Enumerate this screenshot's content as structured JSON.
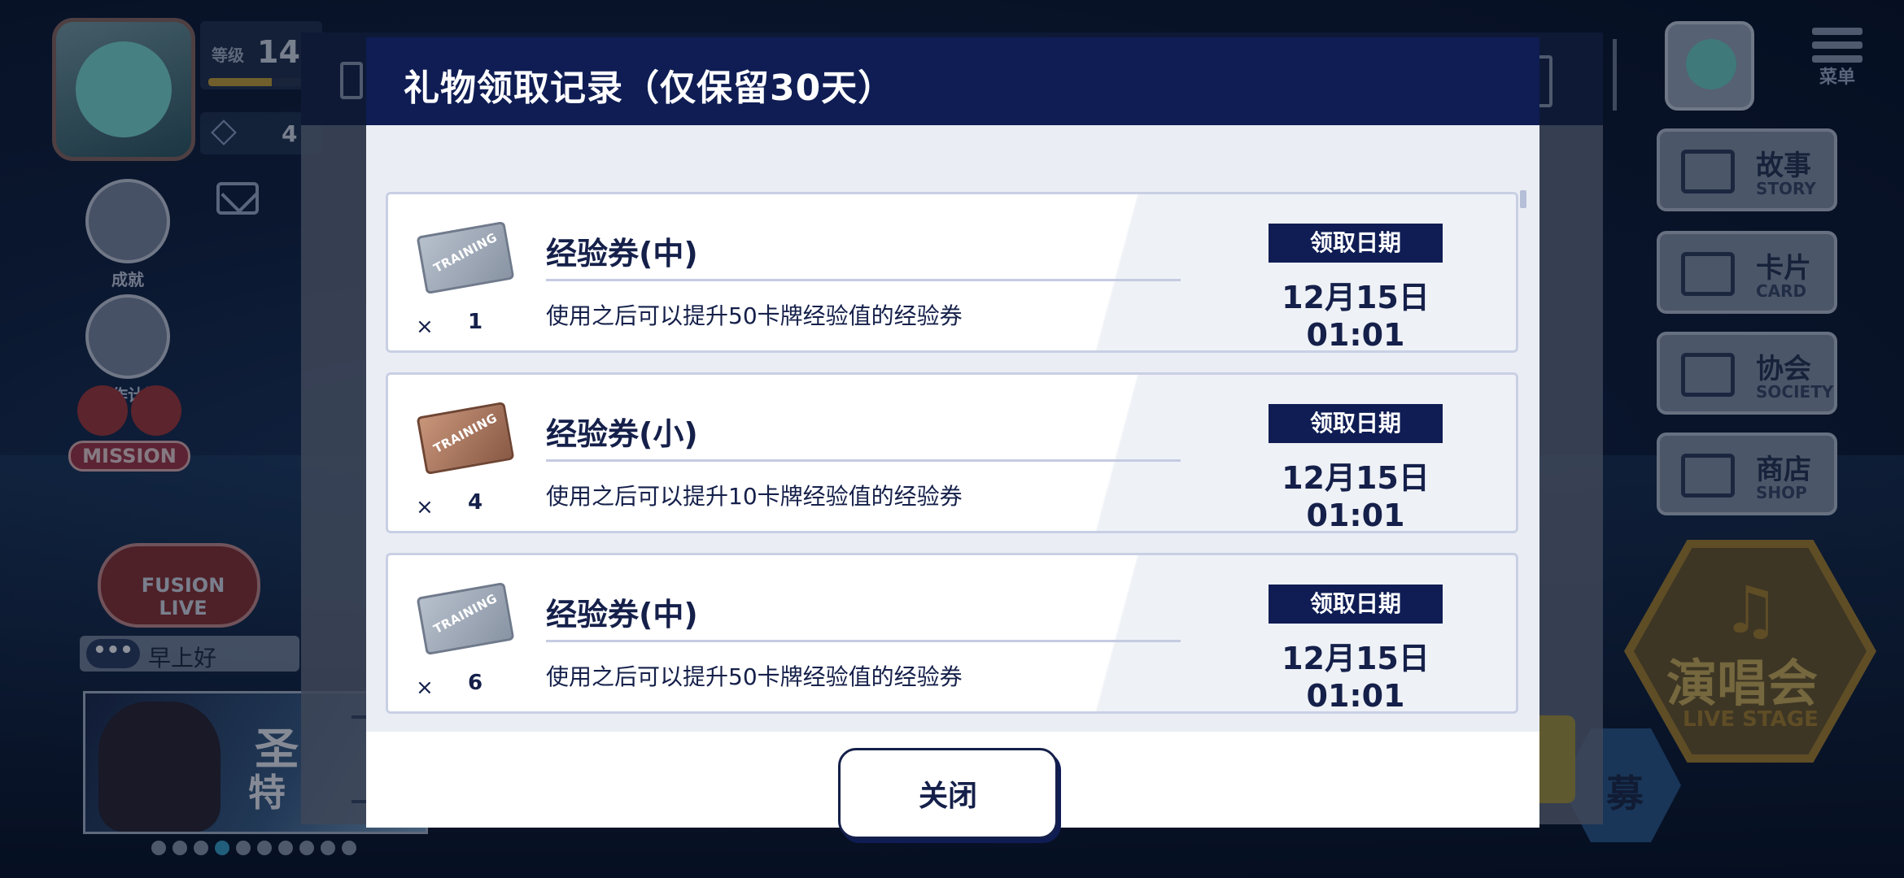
{
  "hud": {
    "level_label": "等级",
    "level_value": "14",
    "level_progress": 0.65,
    "gem_value": "4",
    "achievement_label": "成就",
    "work_plan_label": "工作计划",
    "mission_label": "MISSION",
    "fusion_label": "FUSION LIVE",
    "chat_dots": "•••",
    "chat_text": "早上好",
    "banner_title": "圣",
    "banner_sub": "特",
    "pager": {
      "count": 10,
      "active": 3
    }
  },
  "right_nav": {
    "menu_label": "菜单",
    "items": [
      {
        "cn": "故事",
        "en": "STORY"
      },
      {
        "cn": "卡片",
        "en": "CARD"
      },
      {
        "cn": "协会",
        "en": "SOCIETY"
      },
      {
        "cn": "商店",
        "en": "SHOP"
      }
    ],
    "live_cn": "演唱会",
    "live_en": "LIVE STAGE",
    "scout_cn": "募"
  },
  "modal": {
    "title": "礼物领取记录（仅保留30天）",
    "close_label": "关闭",
    "date_tag_label": "领取日期",
    "quantity_prefix": "×",
    "ticket_text": "TRAINING",
    "gifts": [
      {
        "name": "经验券(中)",
        "desc": "使用之后可以提升50卡牌经验值的经验券",
        "qty": "1",
        "date": "12月15日 01:01",
        "ticket": "mid"
      },
      {
        "name": "经验券(小)",
        "desc": "使用之后可以提升10卡牌经验值的经验券",
        "qty": "4",
        "date": "12月15日 01:01",
        "ticket": "small"
      },
      {
        "name": "经验券(中)",
        "desc": "使用之后可以提升50卡牌经验值的经验券",
        "qty": "6",
        "date": "12月15日 01:01",
        "ticket": "mid"
      }
    ]
  }
}
